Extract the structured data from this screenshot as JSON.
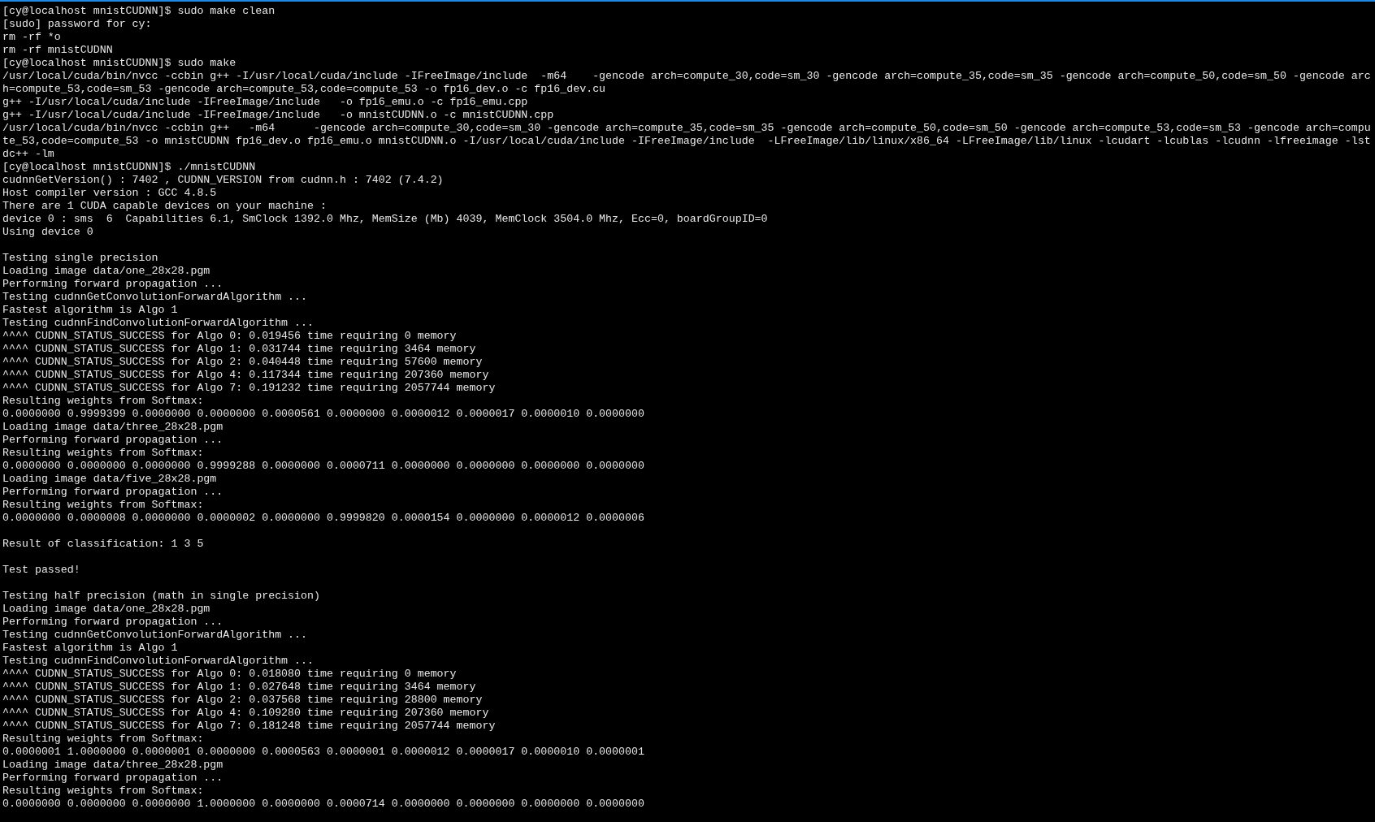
{
  "terminal": {
    "blocks": [
      [
        "[cy@localhost mnistCUDNN]$ sudo make clean",
        "[sudo] password for cy:",
        "rm -rf *o",
        "rm -rf mnistCUDNN",
        "[cy@localhost mnistCUDNN]$ sudo make",
        "/usr/local/cuda/bin/nvcc -ccbin g++ -I/usr/local/cuda/include -IFreeImage/include  -m64    -gencode arch=compute_30,code=sm_30 -gencode arch=compute_35,code=sm_35 -gencode arch=compute_50,code=sm_50 -gencode arc",
        "h=compute_53,code=sm_53 -gencode arch=compute_53,code=compute_53 -o fp16_dev.o -c fp16_dev.cu",
        "g++ -I/usr/local/cuda/include -IFreeImage/include   -o fp16_emu.o -c fp16_emu.cpp",
        "g++ -I/usr/local/cuda/include -IFreeImage/include   -o mnistCUDNN.o -c mnistCUDNN.cpp",
        "/usr/local/cuda/bin/nvcc -ccbin g++   -m64      -gencode arch=compute_30,code=sm_30 -gencode arch=compute_35,code=sm_35 -gencode arch=compute_50,code=sm_50 -gencode arch=compute_53,code=sm_53 -gencode arch=compu",
        "te_53,code=compute_53 -o mnistCUDNN fp16_dev.o fp16_emu.o mnistCUDNN.o -I/usr/local/cuda/include -IFreeImage/include  -LFreeImage/lib/linux/x86_64 -LFreeImage/lib/linux -lcudart -lcublas -lcudnn -lfreeimage -lst",
        "dc++ -lm",
        "[cy@localhost mnistCUDNN]$ ./mnistCUDNN",
        "cudnnGetVersion() : 7402 , CUDNN_VERSION from cudnn.h : 7402 (7.4.2)",
        "Host compiler version : GCC 4.8.5",
        "There are 1 CUDA capable devices on your machine :",
        "device 0 : sms  6  Capabilities 6.1, SmClock 1392.0 Mhz, MemSize (Mb) 4039, MemClock 3504.0 Mhz, Ecc=0, boardGroupID=0",
        "Using device 0"
      ],
      [
        "Testing single precision",
        "Loading image data/one_28x28.pgm",
        "Performing forward propagation ...",
        "Testing cudnnGetConvolutionForwardAlgorithm ...",
        "Fastest algorithm is Algo 1",
        "Testing cudnnFindConvolutionForwardAlgorithm ...",
        "^^^^ CUDNN_STATUS_SUCCESS for Algo 0: 0.019456 time requiring 0 memory",
        "^^^^ CUDNN_STATUS_SUCCESS for Algo 1: 0.031744 time requiring 3464 memory",
        "^^^^ CUDNN_STATUS_SUCCESS for Algo 2: 0.040448 time requiring 57600 memory",
        "^^^^ CUDNN_STATUS_SUCCESS for Algo 4: 0.117344 time requiring 207360 memory",
        "^^^^ CUDNN_STATUS_SUCCESS for Algo 7: 0.191232 time requiring 2057744 memory",
        "Resulting weights from Softmax:",
        "0.0000000 0.9999399 0.0000000 0.0000000 0.0000561 0.0000000 0.0000012 0.0000017 0.0000010 0.0000000",
        "Loading image data/three_28x28.pgm",
        "Performing forward propagation ...",
        "Resulting weights from Softmax:",
        "0.0000000 0.0000000 0.0000000 0.9999288 0.0000000 0.0000711 0.0000000 0.0000000 0.0000000 0.0000000",
        "Loading image data/five_28x28.pgm",
        "Performing forward propagation ...",
        "Resulting weights from Softmax:",
        "0.0000000 0.0000008 0.0000000 0.0000002 0.0000000 0.9999820 0.0000154 0.0000000 0.0000012 0.0000006"
      ],
      [
        "Result of classification: 1 3 5"
      ],
      [
        "Test passed!"
      ],
      [
        "Testing half precision (math in single precision)",
        "Loading image data/one_28x28.pgm",
        "Performing forward propagation ...",
        "Testing cudnnGetConvolutionForwardAlgorithm ...",
        "Fastest algorithm is Algo 1",
        "Testing cudnnFindConvolutionForwardAlgorithm ...",
        "^^^^ CUDNN_STATUS_SUCCESS for Algo 0: 0.018080 time requiring 0 memory",
        "^^^^ CUDNN_STATUS_SUCCESS for Algo 1: 0.027648 time requiring 3464 memory",
        "^^^^ CUDNN_STATUS_SUCCESS for Algo 2: 0.037568 time requiring 28800 memory",
        "^^^^ CUDNN_STATUS_SUCCESS for Algo 4: 0.109280 time requiring 207360 memory",
        "^^^^ CUDNN_STATUS_SUCCESS for Algo 7: 0.181248 time requiring 2057744 memory",
        "Resulting weights from Softmax:",
        "0.0000001 1.0000000 0.0000001 0.0000000 0.0000563 0.0000001 0.0000012 0.0000017 0.0000010 0.0000001",
        "Loading image data/three_28x28.pgm",
        "Performing forward propagation ...",
        "Resulting weights from Softmax:",
        "0.0000000 0.0000000 0.0000000 1.0000000 0.0000000 0.0000714 0.0000000 0.0000000 0.0000000 0.0000000"
      ]
    ]
  }
}
